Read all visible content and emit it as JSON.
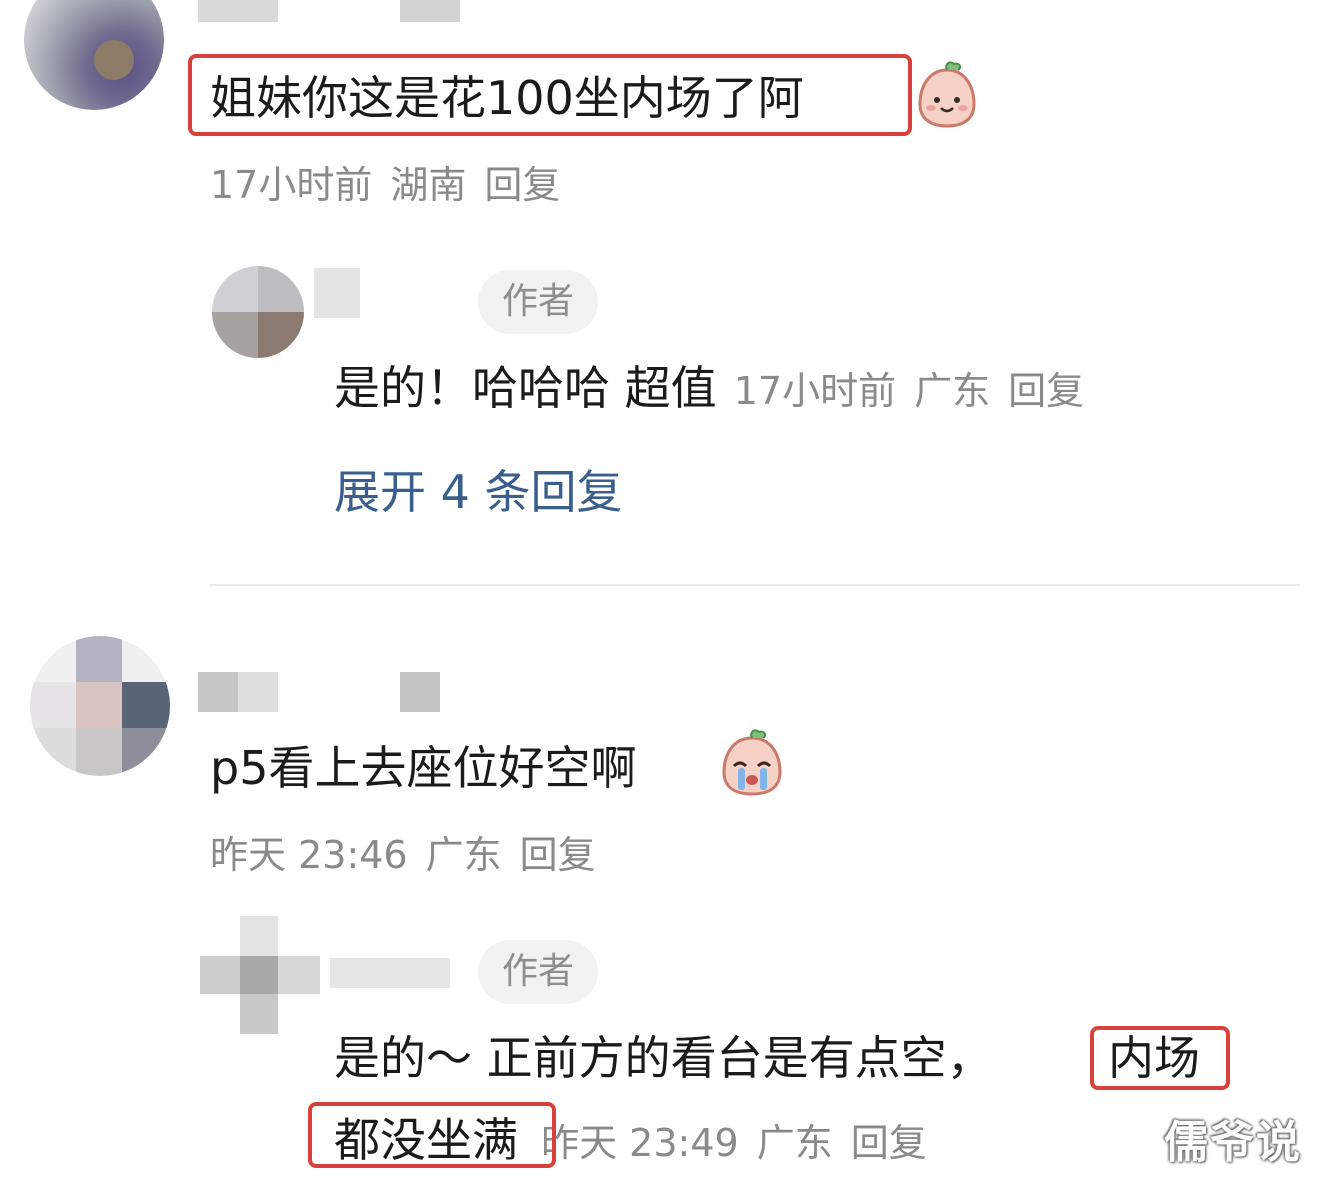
{
  "comments": [
    {
      "text": "姐妹你这是花100坐内场了阿",
      "meta": {
        "time": "17小时前",
        "location": "湖南",
        "reply_label": "回复"
      },
      "reply": {
        "badge": "作者",
        "text": "是的！哈哈哈 超值",
        "meta": {
          "time": "17小时前",
          "location": "广东",
          "reply_label": "回复"
        },
        "expand_label": "展开 4 条回复"
      }
    },
    {
      "text": "p5看上去座位好空啊",
      "meta": {
        "time": "昨天 23:46",
        "location": "广东",
        "reply_label": "回复"
      },
      "reply": {
        "badge": "作者",
        "text_line1": "是的～ 正前方的看台是有点空，",
        "text_highlight1": "内场",
        "text_highlight2": "都没坐满",
        "meta": {
          "time": "昨天 23:49",
          "location": "广东",
          "reply_label": "回复"
        }
      }
    }
  ],
  "watermark": "儒爷说",
  "colors": {
    "highlight": "#d8403c",
    "expand_link": "#3a5f8c",
    "meta_gray": "#8a8a8a"
  }
}
